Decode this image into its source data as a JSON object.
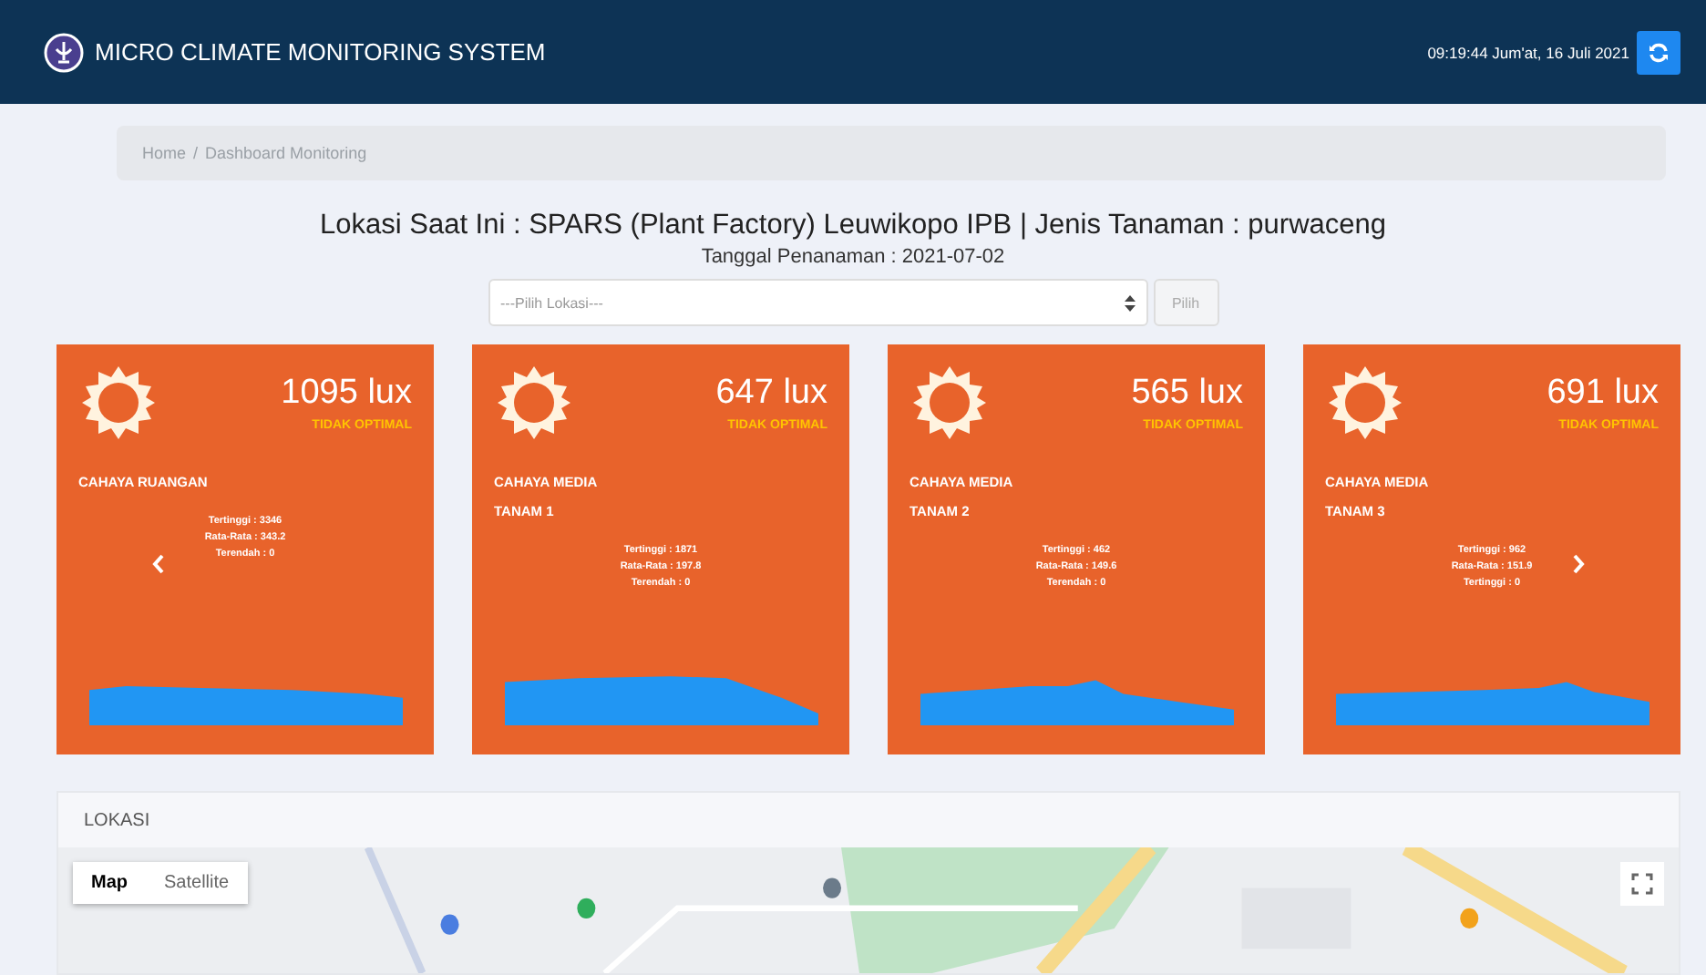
{
  "header": {
    "title": "MICRO CLIMATE MONITORING SYSTEM",
    "datetime": "09:19:44 Jum'at, 16 Juli 2021"
  },
  "breadcrumb": [
    "Home",
    "Dashboard Monitoring"
  ],
  "breadcrumb_separator": "/",
  "location_line": "Lokasi Saat Ini : SPARS (Plant Factory) Leuwikopo IPB | Jenis Tanaman : purwaceng",
  "planting_date": "Tanggal Penanaman : 2021-07-02",
  "location_select": {
    "value": "---Pilih Lokasi---",
    "button": "Pilih"
  },
  "cards": [
    {
      "value": "1095 lux",
      "status": "TIDAK OPTIMAL",
      "label": [
        "CAHAYA RUANGAN"
      ],
      "stats": [
        "Tertinggi : 3346",
        "Rata-Rata : 343.2",
        "Terendah : 0"
      ],
      "prev_arrow": true
    },
    {
      "value": "647 lux",
      "status": "TIDAK OPTIMAL",
      "label": [
        "CAHAYA MEDIA",
        "TANAM 1"
      ],
      "stats": [
        "Tertinggi : 1871",
        "Rata-Rata : 197.8",
        "Terendah : 0"
      ]
    },
    {
      "value": "565 lux",
      "status": "TIDAK OPTIMAL",
      "label": [
        "CAHAYA MEDIA",
        "TANAM 2"
      ],
      "stats": [
        "Tertinggi : 462",
        "Rata-Rata : 149.6",
        "Terendah : 0"
      ]
    },
    {
      "value": "691 lux",
      "status": "TIDAK OPTIMAL",
      "label": [
        "CAHAYA MEDIA",
        "TANAM 3"
      ],
      "stats": [
        "Tertinggi : 962",
        "Rata-Rata : 151.9",
        "Tertinggi : 0"
      ],
      "next_arrow": true
    }
  ],
  "location_panel": {
    "title": "LOKASI",
    "map_types": [
      {
        "label": "Map",
        "selected": true
      },
      {
        "label": "Satellite",
        "selected": false
      }
    ]
  }
}
